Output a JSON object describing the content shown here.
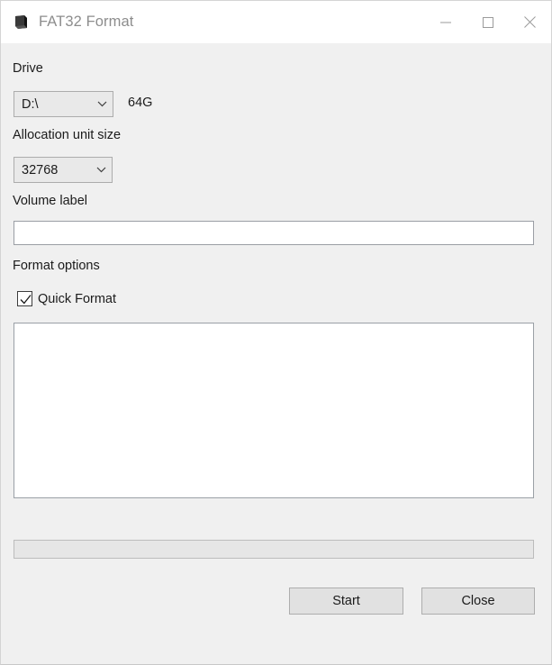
{
  "window": {
    "title": "FAT32 Format",
    "icon": "app-icon",
    "controls": {
      "minimize": "minimize-icon",
      "maximize": "maximize-icon",
      "close": "close-icon"
    }
  },
  "form": {
    "drive": {
      "label": "Drive",
      "selected": "D:\\",
      "options": [
        "D:\\"
      ],
      "capacity": "64G"
    },
    "allocation_unit_size": {
      "label": "Allocation unit size",
      "selected": "32768",
      "options": [
        "32768"
      ]
    },
    "volume_label": {
      "label": "Volume label",
      "value": "",
      "placeholder": ""
    },
    "format_options": {
      "label": "Format options",
      "quick_format": {
        "label": "Quick Format",
        "checked": "true"
      }
    }
  },
  "log": {
    "text": ""
  },
  "progress": {
    "percent": "0"
  },
  "buttons": {
    "start": "Start",
    "close": "Close"
  },
  "colors": {
    "window_bg": "#f0f0f0",
    "titlebar_bg": "#ffffff",
    "title_text": "#8d8d8d",
    "text": "#1b1b1b",
    "control_border": "#acacac",
    "input_bg": "#ffffff",
    "progress_fill": "#06b025"
  }
}
